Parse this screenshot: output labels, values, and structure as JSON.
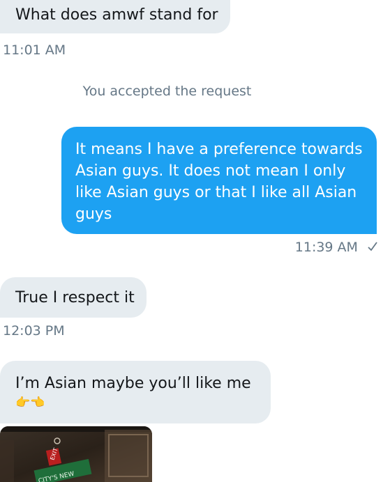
{
  "messages": [
    {
      "text": "What does amwf stand for",
      "time": "11:01 AM"
    },
    {
      "text": "You accepted the request"
    },
    {
      "text": "It means I have a preference towards Asian guys. It does not mean I only like Asian guys or that I like all Asian guys",
      "time": "11:39 AM"
    },
    {
      "text": "True I respect it",
      "time": "12:03 PM"
    },
    {
      "text": "I’m Asian maybe you’ll like me",
      "emoji": "👉👈"
    }
  ],
  "image_preview": {
    "sign_text": "EXIT",
    "banner_text": "CITY'S NEW"
  },
  "colors": {
    "outgoing_bubble": "#1da1f2",
    "incoming_bubble": "#e6ecf0",
    "meta_text": "#657786"
  }
}
